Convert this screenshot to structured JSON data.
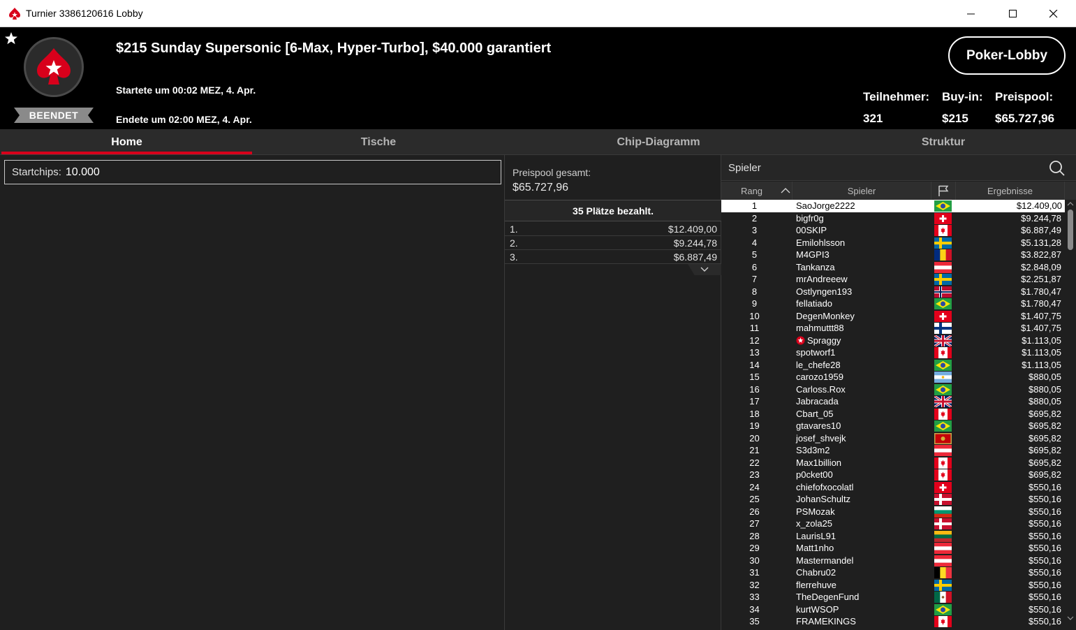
{
  "window": {
    "title": "Turnier 3386120616 Lobby"
  },
  "header": {
    "status": "BEENDET",
    "title": "$215 Sunday Supersonic [6-Max, Hyper-Turbo], $40.000 garantiert",
    "started": "Startete um 00:02 MEZ, 4. Apr.",
    "ended": "Endete um 02:00 MEZ, 4. Apr.",
    "lobby_button": "Poker-Lobby",
    "stats": {
      "players_label": "Teilnehmer:",
      "players_value": "321",
      "buyin_label": "Buy-in:",
      "buyin_value": "$215",
      "prizepool_label": "Preispool:",
      "prizepool_value": "$65.727,96"
    }
  },
  "tabs": [
    "Home",
    "Tische",
    "Chip-Diagramm",
    "Struktur"
  ],
  "home": {
    "startchips_label": "Startchips:",
    "startchips_value": "10.000"
  },
  "prizes": {
    "total_label": "Preispool gesamt:",
    "total_value": "$65.727,96",
    "paid_label": "35 Plätze bezahlt.",
    "payouts": [
      {
        "place": "1.",
        "amount": "$12.409,00"
      },
      {
        "place": "2.",
        "amount": "$9.244,78"
      },
      {
        "place": "3.",
        "amount": "$6.887,49"
      }
    ]
  },
  "players": {
    "search_placeholder": "Spieler",
    "col_rank": "Rang",
    "col_player": "Spieler",
    "col_result": "Ergebnisse",
    "rows": [
      {
        "rank": "1",
        "name": "SaoJorge2222",
        "flag": "br",
        "result": "$12.409,00"
      },
      {
        "rank": "2",
        "name": "bigfr0g",
        "flag": "ch",
        "result": "$9.244,78"
      },
      {
        "rank": "3",
        "name": "00SKIP",
        "flag": "ca",
        "result": "$6.887,49"
      },
      {
        "rank": "4",
        "name": "Emilohlsson",
        "flag": "se",
        "result": "$5.131,28"
      },
      {
        "rank": "5",
        "name": "M4GPI3",
        "flag": "ro",
        "result": "$3.822,87"
      },
      {
        "rank": "6",
        "name": "Tankanza",
        "flag": "at",
        "result": "$2.848,09"
      },
      {
        "rank": "7",
        "name": "mrAndreeew",
        "flag": "se",
        "result": "$2.251,87"
      },
      {
        "rank": "8",
        "name": "Ostlyngen193",
        "flag": "no",
        "result": "$1.780,47"
      },
      {
        "rank": "9",
        "name": "fellatiado",
        "flag": "br",
        "result": "$1.780,47"
      },
      {
        "rank": "10",
        "name": "DegenMonkey",
        "flag": "ch",
        "result": "$1.407,75"
      },
      {
        "rank": "11",
        "name": "mahmuttt88",
        "flag": "fi",
        "result": "$1.407,75"
      },
      {
        "rank": "12",
        "name": "Spraggy",
        "flag": "gb",
        "result": "$1.113,05",
        "pro": true
      },
      {
        "rank": "13",
        "name": "spotworf1",
        "flag": "ca",
        "result": "$1.113,05"
      },
      {
        "rank": "14",
        "name": "le_chefe28",
        "flag": "br",
        "result": "$1.113,05"
      },
      {
        "rank": "15",
        "name": "carozo1959",
        "flag": "ar",
        "result": "$880,05"
      },
      {
        "rank": "16",
        "name": "Carloss.Rox",
        "flag": "br",
        "result": "$880,05"
      },
      {
        "rank": "17",
        "name": "Jabracada",
        "flag": "gb",
        "result": "$880,05"
      },
      {
        "rank": "18",
        "name": "Cbart_05",
        "flag": "ca",
        "result": "$695,82"
      },
      {
        "rank": "19",
        "name": "gtavares10",
        "flag": "br",
        "result": "$695,82"
      },
      {
        "rank": "20",
        "name": "josef_shvejk",
        "flag": "me",
        "result": "$695,82"
      },
      {
        "rank": "21",
        "name": "S3d3m2",
        "flag": "at",
        "result": "$695,82"
      },
      {
        "rank": "22",
        "name": "Max1billion",
        "flag": "ca",
        "result": "$695,82"
      },
      {
        "rank": "23",
        "name": "p0cket00",
        "flag": "ca",
        "result": "$695,82"
      },
      {
        "rank": "24",
        "name": "chiefofxocolatl",
        "flag": "ch",
        "result": "$550,16"
      },
      {
        "rank": "25",
        "name": "JohanSchultz",
        "flag": "dk",
        "result": "$550,16"
      },
      {
        "rank": "26",
        "name": "PSMozak",
        "flag": "bg",
        "result": "$550,16"
      },
      {
        "rank": "27",
        "name": "x_zola25",
        "flag": "dk",
        "result": "$550,16"
      },
      {
        "rank": "28",
        "name": "LaurisL91",
        "flag": "lt",
        "result": "$550,16"
      },
      {
        "rank": "29",
        "name": "Matt1nho",
        "flag": "at",
        "result": "$550,16"
      },
      {
        "rank": "30",
        "name": "Mastermandel",
        "flag": "at",
        "result": "$550,16"
      },
      {
        "rank": "31",
        "name": "Chabru02",
        "flag": "be",
        "result": "$550,16"
      },
      {
        "rank": "32",
        "name": "flerrehuve",
        "flag": "se",
        "result": "$550,16"
      },
      {
        "rank": "33",
        "name": "TheDegenFund",
        "flag": "mx",
        "result": "$550,16"
      },
      {
        "rank": "34",
        "name": "kurtWSOP",
        "flag": "br",
        "result": "$550,16"
      },
      {
        "rank": "35",
        "name": "FRAMEKINGS",
        "flag": "ca",
        "result": "$550,16"
      }
    ]
  },
  "colors": {
    "accent": "#d8001b",
    "background": "#1f1f1f",
    "header": "#000000"
  }
}
